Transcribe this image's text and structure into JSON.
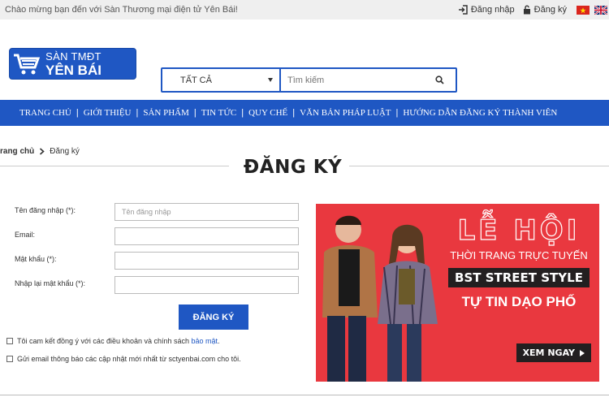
{
  "topbar": {
    "welcome": "Chào mừng bạn đến với Sàn Thương mại điện tử Yên Bái!",
    "login": "Đăng nhập",
    "register": "Đăng ký"
  },
  "logo": {
    "line1": "SÀN TMĐT",
    "line2": "YÊN BÁI"
  },
  "search": {
    "category": "TẤT CẢ",
    "placeholder": "Tìm kiếm"
  },
  "nav": {
    "items": [
      "TRANG CHỦ",
      "GIỚI THIỆU",
      "SẢN PHẨM",
      "TIN TỨC",
      "QUY CHẾ",
      "VĂN BẢN PHÁP LUẬT",
      "HƯỚNG DẪN ĐĂNG KÝ THÀNH VIÊN"
    ]
  },
  "breadcrumb": {
    "home": "rang chủ",
    "current": "Đăng ký"
  },
  "page_title": "ĐĂNG KÝ",
  "form": {
    "username_label": "Tên đăng nhập (*):",
    "username_placeholder": "Tên đăng nhập",
    "email_label": "Email:",
    "password_label": "Mật khẩu (*):",
    "confirm_label": "Nhập lại mật khẩu (*):",
    "submit": "ĐĂNG KÝ",
    "agree_text": "Tôi cam kết đồng ý với các điều khoản và chính sách ",
    "agree_link": "bảo mật",
    "agree_end": ".",
    "newsletter_text": "Gửi email thông báo các cập nhật mới nhất từ sctyenbai.com cho tôi."
  },
  "banner": {
    "festival": "LỄ HỘI",
    "online": "THỜI TRANG TRỰC TUYẾN",
    "bst": "BST STREET STYLE",
    "confident": "TỰ TIN DẠO PHỐ",
    "cta": "XEM NGAY"
  },
  "colors": {
    "brand_blue": "#1f57c3",
    "banner_red": "#e9383f"
  }
}
